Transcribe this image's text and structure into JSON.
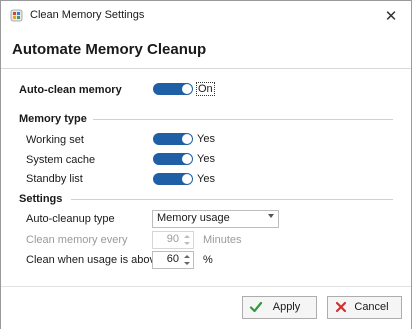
{
  "window": {
    "title": "Clean Memory Settings",
    "close_glyph": "✕"
  },
  "header": {
    "title": "Automate Memory Cleanup"
  },
  "auto_clean": {
    "label": "Auto-clean memory",
    "state": "On",
    "enabled": true
  },
  "memory_type": {
    "heading": "Memory type",
    "items": [
      {
        "label": "Working set",
        "state": "Yes",
        "enabled": true
      },
      {
        "label": "System cache",
        "state": "Yes",
        "enabled": true
      },
      {
        "label": "Standby list",
        "state": "Yes",
        "enabled": true
      }
    ]
  },
  "settings": {
    "heading": "Settings",
    "cleanup_type": {
      "label": "Auto-cleanup type",
      "value": "Memory usage"
    },
    "clean_every": {
      "label": "Clean memory every",
      "value": "90",
      "unit": "Minutes",
      "disabled": true
    },
    "usage_above": {
      "label": "Clean when usage is above",
      "value": "60",
      "unit": "%"
    }
  },
  "footer": {
    "apply_label": "Apply",
    "cancel_label": "Cancel"
  },
  "colors": {
    "toggle_on": "#1f5fa6",
    "apply_check": "#2e9b3a",
    "cancel_x": "#d32f2f"
  },
  "icons": {
    "app": "memory-cleaner-icon",
    "close": "close-icon",
    "apply": "checkmark-icon",
    "cancel": "x-mark-icon"
  }
}
